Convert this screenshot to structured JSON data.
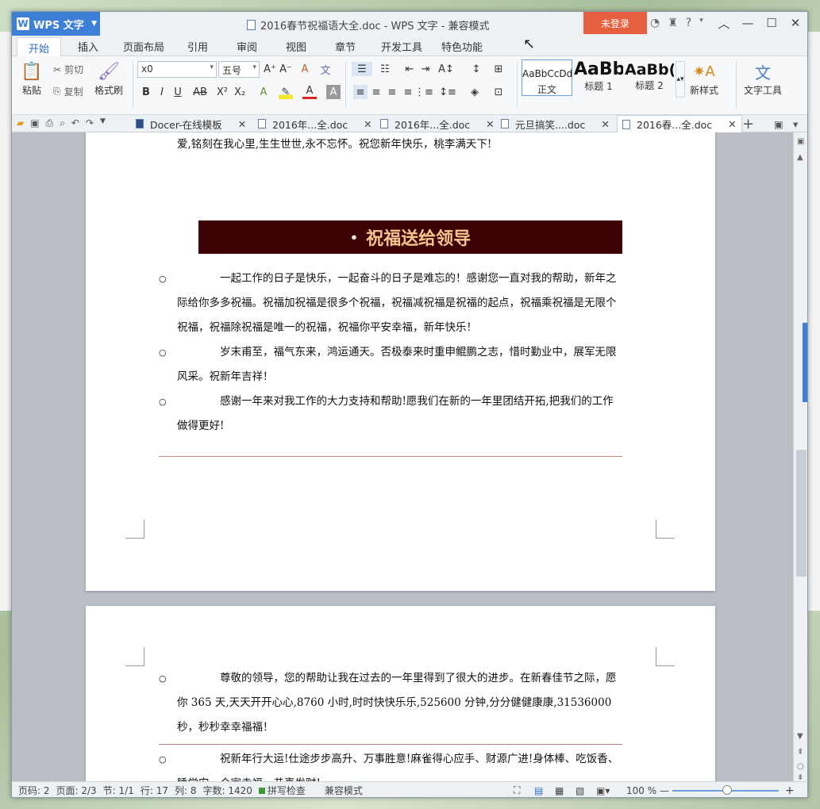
{
  "app": {
    "logo_label": "WPS 文字",
    "window_title": "2016春节祝福语大全.doc - WPS 文字 - 兼容模式",
    "login_label": "未登录"
  },
  "menu": {
    "tabs": [
      "开始",
      "插入",
      "页面布局",
      "引用",
      "审阅",
      "视图",
      "章节",
      "开发工具",
      "特色功能"
    ]
  },
  "ribbon": {
    "paste": "粘贴",
    "cut": "剪切",
    "copy": "复制",
    "format_painter": "格式刷",
    "font_name": "x0",
    "font_size": "五号",
    "styles": [
      {
        "preview": "AaBbCcDd",
        "label": "正文"
      },
      {
        "preview": "AaBb",
        "label": "标题 1"
      },
      {
        "preview": "AaBb(",
        "label": "标题 2"
      }
    ],
    "new_style": "新样式",
    "text_tools": "文字工具"
  },
  "doc_tabs": [
    {
      "label": "Docer-在线模板",
      "active": false
    },
    {
      "label": "2016年...全.doc",
      "active": false
    },
    {
      "label": "2016年...全.doc",
      "active": false
    },
    {
      "label": "元旦搞笑....doc",
      "active": false
    },
    {
      "label": "2016春...全.doc",
      "active": true
    }
  ],
  "document": {
    "top_line": "爱,铭刻在我心里,生生世世,永不忘怀。祝您新年快乐，桃李满天下!",
    "heading": "祝福送给领导",
    "paras_page1": [
      "一起工作的日子是快乐，一起奋斗的日子是难忘的！感谢您一直对我的帮助，新年之际给你多多祝福。祝福加祝福是很多个祝福，祝福减祝福是祝福的起点，祝福乘祝福是无限个祝福，祝福除祝福是唯一的祝福，祝福你平安幸福，新年快乐！",
      "岁末甫至，福气东来，鸿运通天。否极泰来时重申鲲鹏之志，惜时勤业中，展军无限风采。祝新年吉祥！",
      "感谢一年来对我工作的大力支持和帮助!愿我们在新的一年里团结开拓,把我们的工作做得更好!"
    ],
    "paras_page2": [
      "尊敬的领导，您的帮助让我在过去的一年里得到了很大的进步。在新春佳节之际，愿你 365 天,天天开开心心,8760 小时,时时快快乐乐,525600 分钟,分分健健康康,31536000 秒，秒秒幸幸福福！",
      "祝新年行大运!仕途步步高升、万事胜意!麻雀得心应手、财源广进!身体棒、吃饭香、睡觉安，合家幸福，恭喜发财!"
    ]
  },
  "status": {
    "page_num": "页码: 2",
    "pages": "页面: 2/3",
    "section": "节: 1/1",
    "row": "行: 17",
    "col": "列: 8",
    "words": "字数: 1420",
    "spellcheck": "拼写检查",
    "compat": "兼容模式",
    "zoom": "100 %"
  }
}
